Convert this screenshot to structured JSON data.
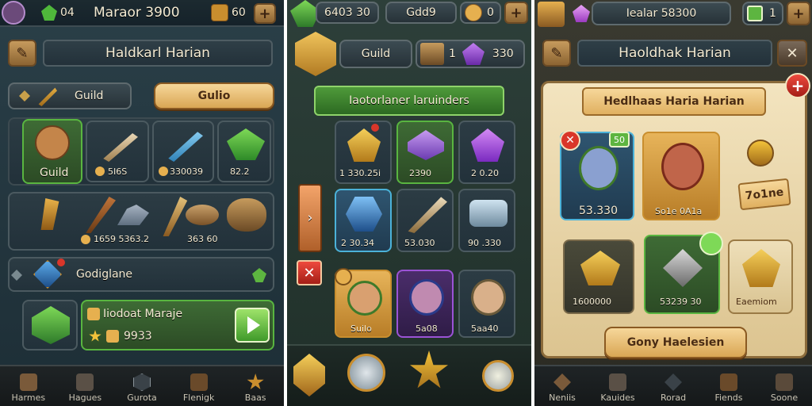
{
  "panel1": {
    "topbar": {
      "gems": "04",
      "title": "Maraor 3900",
      "gold": "60"
    },
    "header_title": "Haldkarl Harian",
    "guild_label": "Guild",
    "gold_btn_label": "Gulio",
    "items_row1": [
      {
        "label": "Guild"
      },
      {
        "label": "5I6S"
      },
      {
        "label": "330039"
      },
      {
        "label": "82.2"
      }
    ],
    "items_row2_values": "1659 5363.2",
    "items_row2_right": "363 60",
    "list_label": "Godiglane",
    "reward_title": "Iiodoat Maraje",
    "reward_value": "9933",
    "nav": [
      "Harmes",
      "Hagues",
      "Gurota",
      "Flenigk",
      "Baas"
    ]
  },
  "panel2": {
    "top_value": "6403 30",
    "top_label": "Gdd9",
    "top_right": "0",
    "guild_label": "Guild",
    "guild_count": "1",
    "guild_value": "330",
    "banner": "Iaotorlaner laruinders",
    "grid": [
      {
        "label": "1 330.25i"
      },
      {
        "label": "2390"
      },
      {
        "label": "2 0.20"
      },
      {
        "label": "2 30.34"
      },
      {
        "label": "53.030"
      },
      {
        "label": "90 .330"
      },
      {
        "label": "Suilo"
      },
      {
        "label": "5a08"
      },
      {
        "label": "5aa40"
      }
    ]
  },
  "panel3": {
    "topbar_title": "Iealar 58300",
    "topbar_right": "1",
    "header_title": "Haoldhak Harian",
    "scroll_title": "Hedlhaas Haria Harian",
    "char1_value": "53.330",
    "char1_badge": "50",
    "char2_value": "So1e 0A1a",
    "tag_value": "7o1ne",
    "item1_value": "1600000",
    "item2_value": "53239 30",
    "item3_value": "Eaemiom",
    "confirm_label": "Gony Haelesien",
    "nav": [
      "Neniis",
      "Kauides",
      "Rorad",
      "Fiends",
      "Soone"
    ]
  },
  "colors": {
    "gold": "#e6b04f",
    "green": "#5db540",
    "red": "#d9362a",
    "purple": "#8f4bd2",
    "blue": "#3da7d9"
  }
}
